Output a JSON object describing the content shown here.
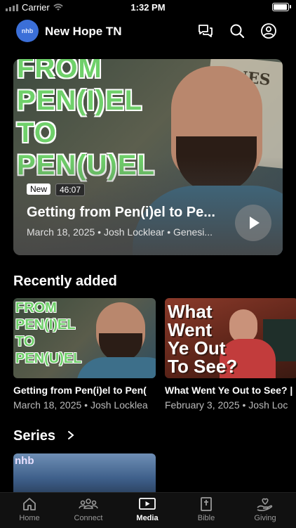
{
  "status_bar": {
    "carrier": "Carrier",
    "time": "1:32 PM"
  },
  "header": {
    "logo_text": "nhb",
    "church_name": "New Hope TN",
    "icons": [
      "chat-icon",
      "search-icon",
      "account-icon"
    ]
  },
  "featured": {
    "badge": "New",
    "duration": "46:07",
    "title": "Getting from Pen(i)el to Pe...",
    "subtitle": "March 18, 2025 • Josh Locklear • Genesi...",
    "thumbnail_text": [
      "FROM",
      "PEN(I)EL",
      "TO",
      "PEN(U)EL"
    ],
    "page_text": "ENES"
  },
  "recently_added": {
    "heading": "Recently added",
    "items": [
      {
        "title": "Getting from Pen(i)el to Pen(",
        "subtitle": "March 18, 2025 • Josh Locklea",
        "thumb_text": [
          "FROM",
          "PEN(I)EL",
          "TO",
          "PEN(U)EL"
        ]
      },
      {
        "title": "What Went Ye Out to See? |",
        "subtitle": "February 3, 2025 • Josh Loc",
        "thumb_text": [
          "What",
          "Went",
          "Ye Out",
          "To See?"
        ]
      }
    ]
  },
  "series": {
    "heading": "Series",
    "thumb_text": "nhb"
  },
  "tabs": [
    {
      "label": "Home",
      "icon": "home-icon",
      "active": false
    },
    {
      "label": "Connect",
      "icon": "people-icon",
      "active": false
    },
    {
      "label": "Media",
      "icon": "play-icon",
      "active": true
    },
    {
      "label": "Bible",
      "icon": "bible-icon",
      "active": false
    },
    {
      "label": "Giving",
      "icon": "giving-icon",
      "active": false
    }
  ]
}
